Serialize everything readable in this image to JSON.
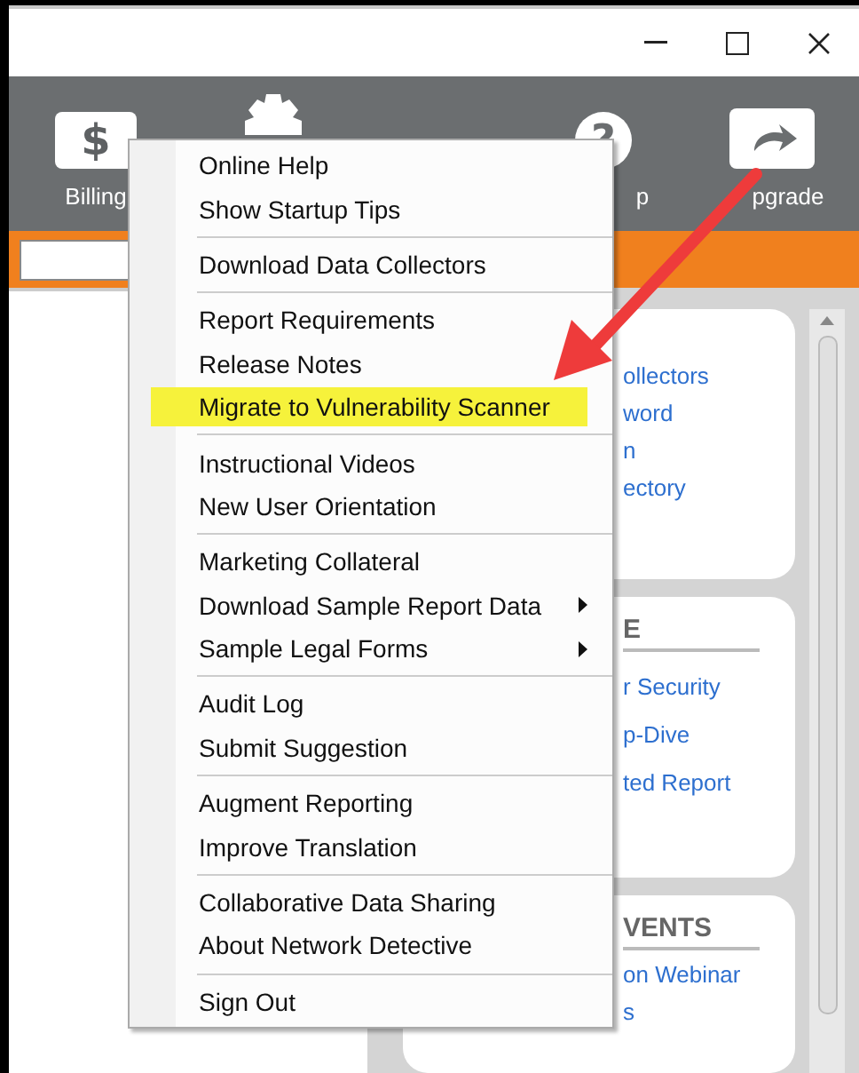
{
  "window": {
    "controls": [
      {
        "kind": "minimize"
      },
      {
        "kind": "maximize"
      },
      {
        "kind": "close"
      }
    ]
  },
  "toolbar": {
    "buttons": [
      {
        "kind": "billing",
        "glyph": "$",
        "label": "Billing"
      },
      {
        "kind": "settings"
      },
      {
        "kind": "help",
        "glyph": "?",
        "label": "p"
      },
      {
        "kind": "upgrade",
        "label": "pgrade"
      }
    ]
  },
  "cards": [
    {
      "links": [
        "ollectors",
        "word",
        "n",
        "ectory"
      ]
    },
    {
      "heading": "E",
      "links": [
        "r Security",
        "p-Dive",
        "ted Report"
      ]
    },
    {
      "heading": "VENTS",
      "links": [
        "on Webinar",
        "s"
      ]
    }
  ],
  "menu": {
    "groups": [
      [
        {
          "label": "Online Help",
          "submenu": false,
          "highlighted": false
        },
        {
          "label": "Show Startup Tips",
          "submenu": false,
          "highlighted": false
        }
      ],
      [
        {
          "label": "Download Data Collectors",
          "submenu": false,
          "highlighted": false
        }
      ],
      [
        {
          "label": "Report Requirements",
          "submenu": false,
          "highlighted": false
        },
        {
          "label": "Release Notes",
          "submenu": false,
          "highlighted": false
        },
        {
          "label": "Migrate to Vulnerability Scanner",
          "submenu": false,
          "highlighted": true
        }
      ],
      [
        {
          "label": "Instructional Videos",
          "submenu": false,
          "highlighted": false
        },
        {
          "label": "New User Orientation",
          "submenu": false,
          "highlighted": false
        }
      ],
      [
        {
          "label": "Marketing Collateral",
          "submenu": false,
          "highlighted": false
        },
        {
          "label": "Download Sample Report Data",
          "submenu": true,
          "highlighted": false
        },
        {
          "label": "Sample Legal Forms",
          "submenu": true,
          "highlighted": false
        }
      ],
      [
        {
          "label": "Audit Log",
          "submenu": false,
          "highlighted": false
        },
        {
          "label": "Submit Suggestion",
          "submenu": false,
          "highlighted": false
        }
      ],
      [
        {
          "label": "Augment Reporting",
          "submenu": false,
          "highlighted": false
        },
        {
          "label": "Improve Translation",
          "submenu": false,
          "highlighted": false
        }
      ],
      [
        {
          "label": "Collaborative Data Sharing",
          "submenu": false,
          "highlighted": false
        },
        {
          "label": "About Network Detective",
          "submenu": false,
          "highlighted": false
        }
      ],
      [
        {
          "label": "Sign Out",
          "submenu": false,
          "highlighted": false
        }
      ]
    ]
  }
}
